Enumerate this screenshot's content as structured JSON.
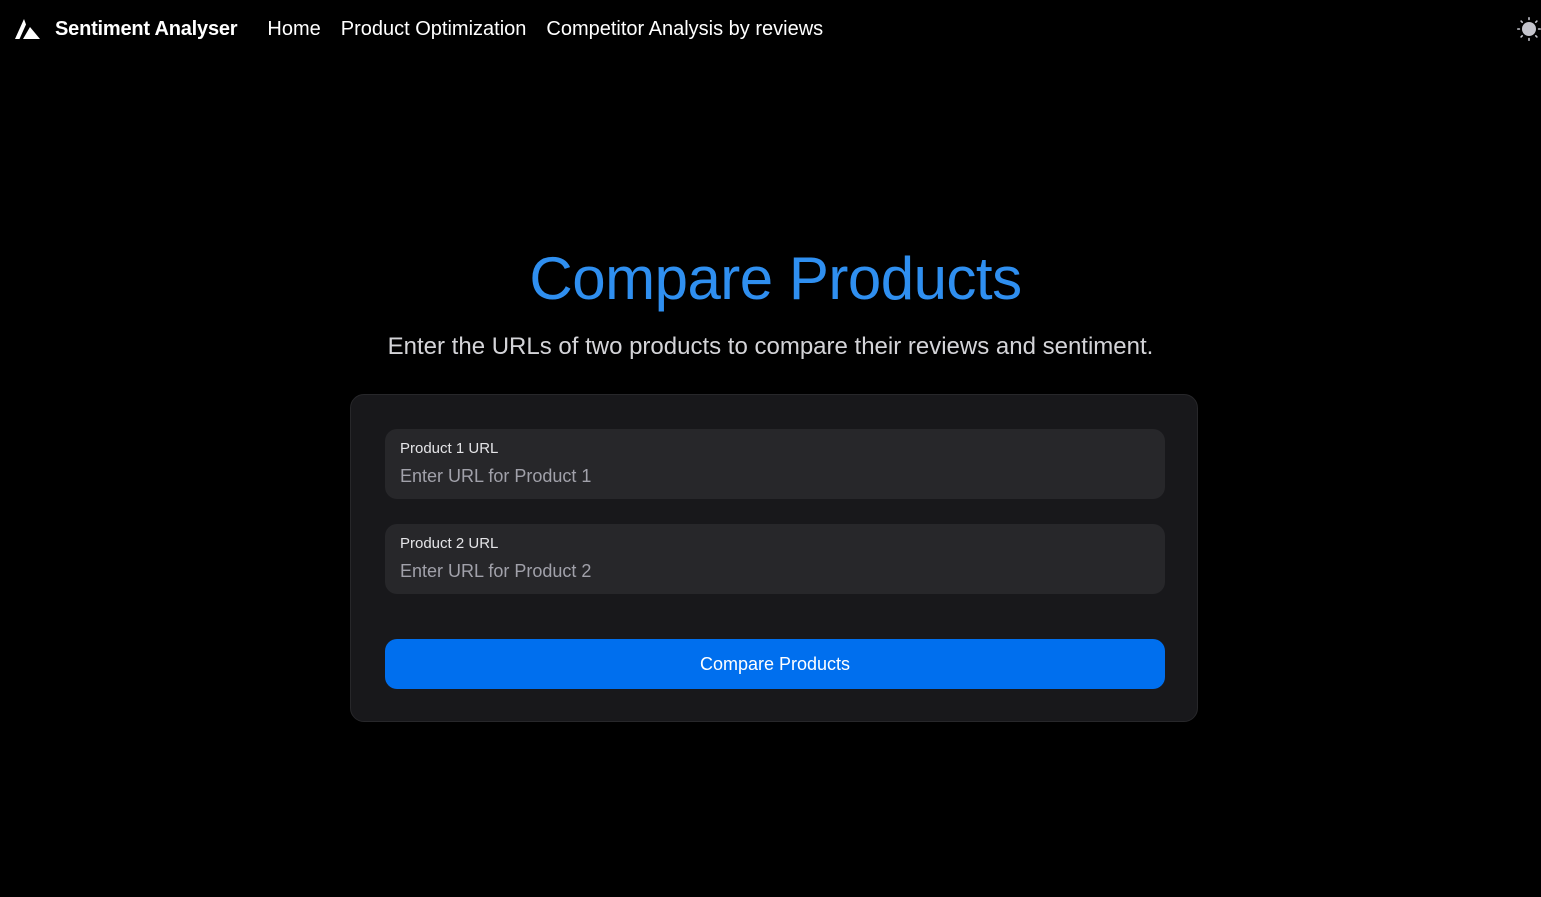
{
  "navbar": {
    "brand": {
      "logo_icon": "triangle-logo-icon",
      "name": "Sentiment Analyser"
    },
    "links": [
      {
        "label": "Home"
      },
      {
        "label": "Product Optimization"
      },
      {
        "label": "Competitor Analysis by reviews"
      }
    ],
    "theme_toggle_icon": "sun-icon"
  },
  "main": {
    "title": "Compare Products",
    "subtitle": "Enter the URLs of two products to compare their reviews and sentiment.",
    "form": {
      "product1": {
        "label": "Product 1 URL",
        "placeholder": "Enter URL for Product 1",
        "value": ""
      },
      "product2": {
        "label": "Product 2 URL",
        "placeholder": "Enter URL for Product 2",
        "value": ""
      },
      "submit_label": "Compare Products"
    }
  },
  "colors": {
    "background": "#000000",
    "title": "#2f8ff0",
    "card": "#18181b",
    "input": "#27272a",
    "primary_button": "#006fee"
  }
}
